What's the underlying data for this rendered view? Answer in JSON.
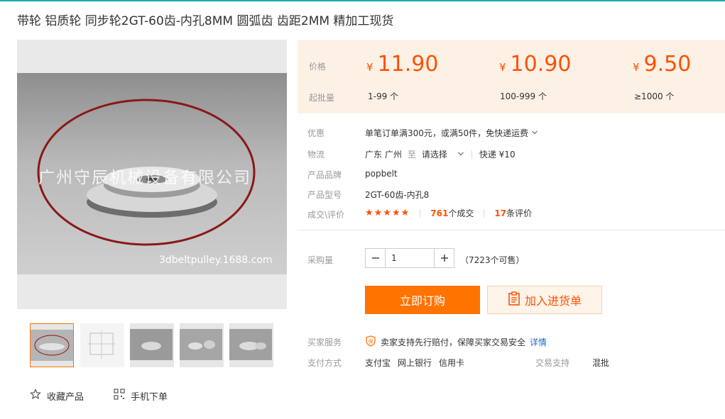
{
  "title": "带轮 铝质轮 同步轮2GT-60齿-内孔8MM 圆弧齿 齿距2MM 精加工现货",
  "image": {
    "watermark_company": "广州守辰机械设备有限公司",
    "watermark_site": "3dbeltpulley.1688.com"
  },
  "price_box": {
    "price_label": "价格",
    "batch_label": "起批量",
    "currency": "¥",
    "tiers": [
      {
        "price": "11.90",
        "range": "1-99 个"
      },
      {
        "price": "10.90",
        "range": "100-999 个"
      },
      {
        "price": "9.50",
        "range": "≥1000 个"
      }
    ]
  },
  "details": {
    "discount_label": "优惠",
    "discount_value": "单笔订单满300元，或满50件，免快递运费",
    "logistics_label": "物流",
    "logistics_from": "广东 广州",
    "logistics_to": "至",
    "logistics_select": "请选择",
    "logistics_express": "快递 ¥10",
    "brand_label": "产品品牌",
    "brand_value": "popbelt",
    "model_label": "产品型号",
    "model_value": "2GT-60齿-内孔8",
    "deal_label": "成交\\评价",
    "stars": "★★★★★",
    "deal_count": "761",
    "deal_suffix": "个成交",
    "review_count": "17",
    "review_suffix": "条评价"
  },
  "purchase": {
    "qty_label": "采购量",
    "qty_value": "1",
    "stock_text": "（7223个可售）",
    "buy_label": "立即订购",
    "cart_label": "加入进货单"
  },
  "service": {
    "service_label": "买家服务",
    "service_text": "卖家支持先行赔付，保障买家交易安全",
    "service_link": "详情",
    "payment_label": "支付方式",
    "payment_methods": [
      "支付宝",
      "网上银行",
      "信用卡"
    ],
    "trade_label": "交易支持",
    "trade_value": "混批"
  },
  "bottom": {
    "favorite_label": "收藏产品",
    "mobile_label": "手机下单"
  },
  "colors": {
    "accent": "#ff5000",
    "button": "#ff7300",
    "price_bg": "#fdf1e6"
  }
}
